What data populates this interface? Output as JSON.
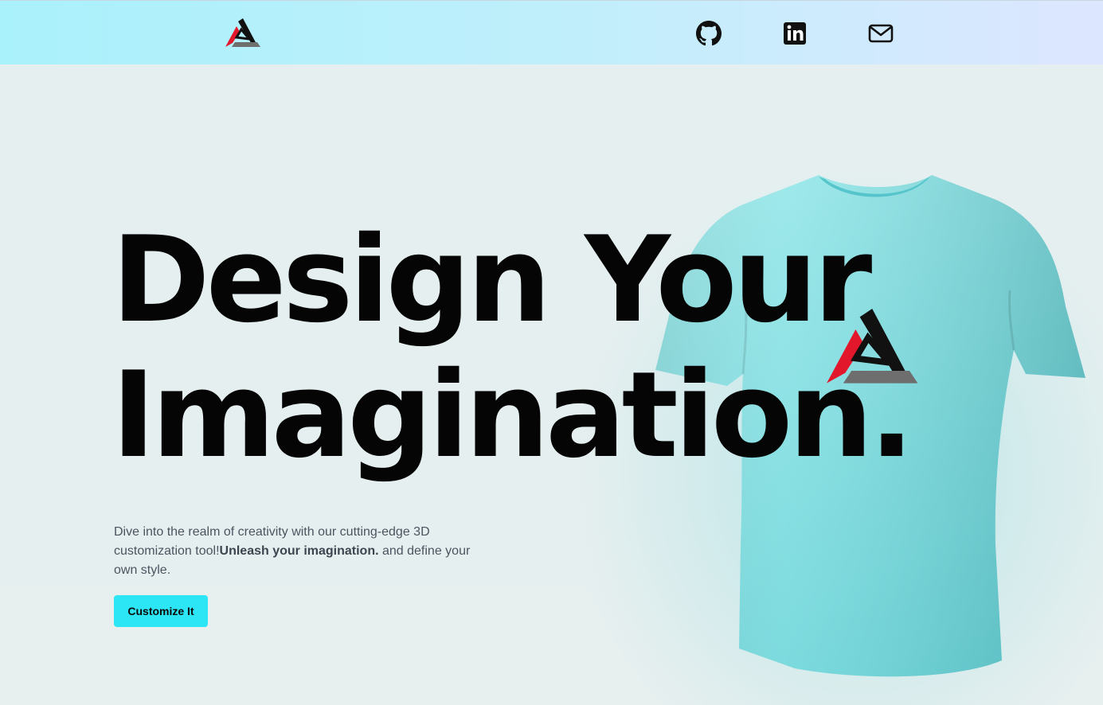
{
  "header": {
    "logo": "brand-triangle-logo",
    "links": [
      {
        "icon": "github-icon"
      },
      {
        "icon": "linkedin-icon"
      },
      {
        "icon": "mail-icon"
      }
    ]
  },
  "hero": {
    "headline_line1": "Design Your",
    "headline_line2": "Imagination.",
    "description_before": "Dive into the realm of creativity with our cutting-edge 3D customization tool!",
    "description_bold": "Unleash your imagination.",
    "description_after": " and define your own style.",
    "cta_label": "Customize It",
    "shirt_color": "#7ad9dc",
    "shirt_logo": "brand-triangle-logo"
  },
  "colors": {
    "accent": "#2ce6f5",
    "logo_red": "#e3172b",
    "logo_black": "#111111",
    "logo_gray": "#6e6e6e"
  }
}
